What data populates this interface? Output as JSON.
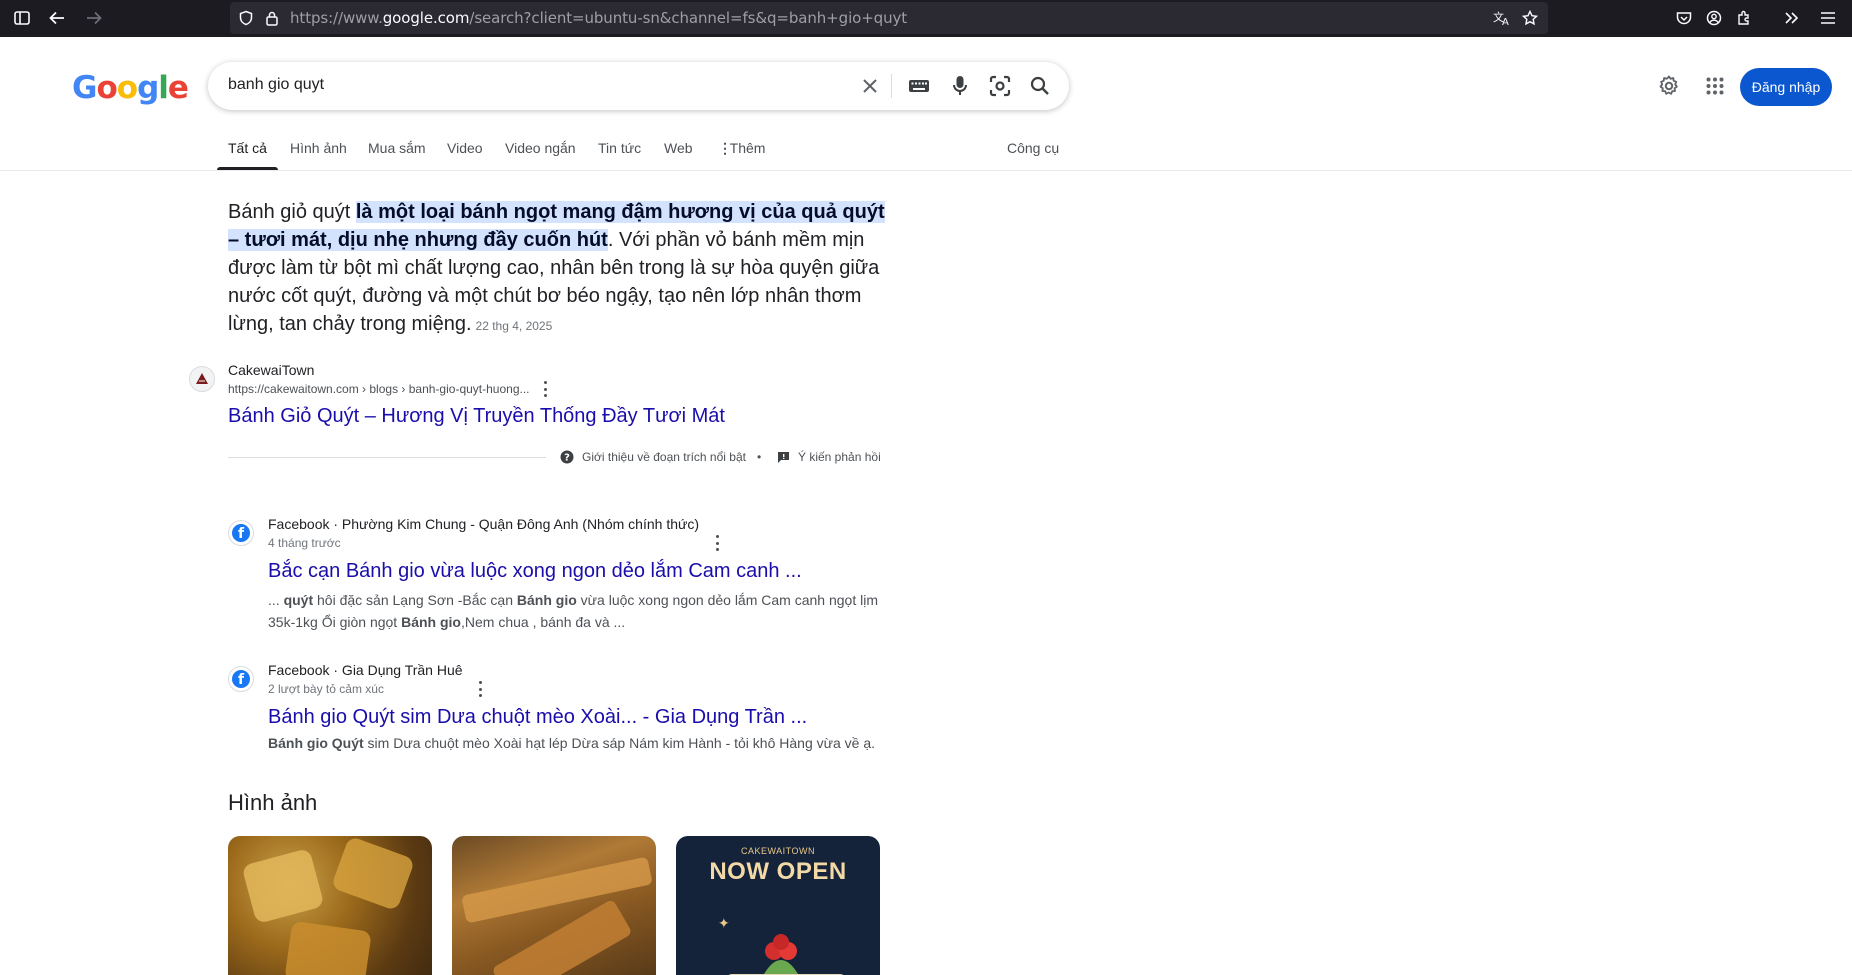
{
  "browser": {
    "url_prefix": "https://www.",
    "url_domain": "google.com",
    "url_path": "/search?client=ubuntu-sn&channel=fs&q=banh+gio+quyt"
  },
  "header": {
    "logo_letters": [
      "G",
      "o",
      "o",
      "g",
      "l",
      "e"
    ],
    "logo_colors": [
      "#4285f4",
      "#ea4335",
      "#fbbc05",
      "#4285f4",
      "#34a853",
      "#ea4335"
    ],
    "query": "banh gio quyt",
    "signin_label": "Đăng nhập"
  },
  "tabs": [
    {
      "label": "Tất cả"
    },
    {
      "label": "Hình ảnh"
    },
    {
      "label": "Mua sắm"
    },
    {
      "label": "Video"
    },
    {
      "label": "Video ngắn"
    },
    {
      "label": "Tin tức"
    },
    {
      "label": "Web"
    },
    {
      "label": "Thêm"
    }
  ],
  "tools_label": "Công cụ",
  "snippet": {
    "lead": "Bánh giỏ quýt ",
    "highlight": "là một loại bánh ngọt mang đậm hương vị của quả quýt – tươi mát, dịu nhẹ nhưng đầy cuốn hút",
    "rest": ". Với phần vỏ bánh mềm mịn được làm từ bột mì chất lượng cao, nhân bên trong là sự hòa quyện giữa nước cốt quýt, đường và một chút bơ béo ngậy, tạo nên lớp nhân thơm lừng, tan chảy trong miệng.",
    "date": "22 thg 4, 2025",
    "source_name": "CakewaiTown",
    "source_url": "https://cakewaitown.com › blogs › banh-gio-quyt-huong...",
    "title": "Bánh Giỏ Quýt – Hương Vị Truyền Thống Đầy Tươi Mát",
    "about_label": "Giới thiệu về đoạn trích nổi bật",
    "feedback_label": "Ý kiến phản hồi"
  },
  "results": [
    {
      "source": "Facebook · Phường Kim Chung - Quận Đông Anh (Nhóm chính thức)",
      "meta": "4 tháng trước",
      "title": "Bắc cạn Bánh gio vừa luộc xong ngon dẻo lắm Cam canh ...",
      "desc_line1_a": "... ",
      "desc_line1_b": "quýt",
      "desc_line1_c": " hôi đặc sản Lạng Sơn -Bắc cạn ",
      "desc_line1_d": "Bánh gio",
      "desc_line1_e": " vừa luộc xong ngon dẻo lắm Cam canh ngọt lịm",
      "desc_line2_a": "35k-1kg Ổi giòn ngọt ",
      "desc_line2_b": "Bánh gio",
      "desc_line2_c": ",Nem chua , bánh đa và ..."
    },
    {
      "source": "Facebook · Gia Dụng Trần Huê",
      "meta": "2 lượt bày tỏ cảm xúc",
      "title": "Bánh gio Quýt sim Dưa chuột mèo Xoài... - Gia Dụng Trần ...",
      "desc_a": "Bánh gio Quýt",
      "desc_b": " sim Dưa chuột mèo Xoài hạt lép Dừa sáp Nám kim Hành - tỏi khô Hàng vừa về ạ."
    }
  ],
  "images_section": {
    "title": "Hình ảnh",
    "card3_brand": "CAKEWAITOWN",
    "card3_text": "NOW OPEN"
  }
}
